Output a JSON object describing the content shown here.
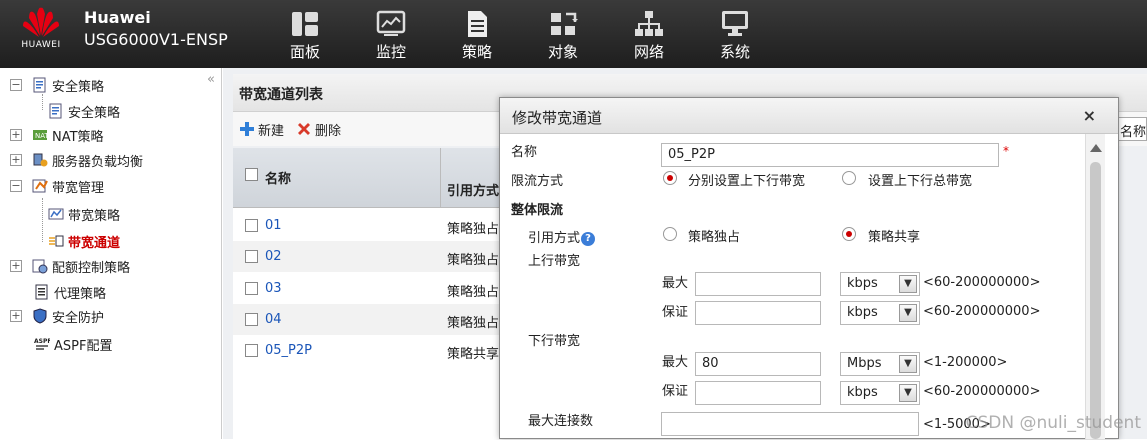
{
  "header": {
    "logo_text": "HUAWEI",
    "brand": "Huawei",
    "device": "USG6000V1-ENSP",
    "nav": [
      {
        "label": "面板",
        "icon": "dashboard-icon"
      },
      {
        "label": "监控",
        "icon": "monitor-chart-icon"
      },
      {
        "label": "策略",
        "icon": "document-icon"
      },
      {
        "label": "对象",
        "icon": "objects-icon"
      },
      {
        "label": "网络",
        "icon": "network-icon"
      },
      {
        "label": "系统",
        "icon": "computer-icon"
      }
    ]
  },
  "sidebar": {
    "collapse_icon": "«",
    "items": [
      {
        "label": "安全策略"
      },
      {
        "label": "安全策略"
      },
      {
        "label": "NAT策略"
      },
      {
        "label": "服务器负载均衡"
      },
      {
        "label": "带宽管理"
      },
      {
        "label": "带宽策略"
      },
      {
        "label": "带宽通道"
      },
      {
        "label": "配额控制策略"
      },
      {
        "label": "代理策略"
      },
      {
        "label": "安全防护"
      },
      {
        "label": "ASPF配置"
      }
    ]
  },
  "list_panel": {
    "title": "带宽通道列表",
    "new_label": "新建",
    "delete_label": "删除",
    "search_value": "名称",
    "col_name": "名称",
    "col_ref": "引用方式",
    "rows": [
      {
        "name": "01",
        "ref": "策略独占"
      },
      {
        "name": "02",
        "ref": "策略独占"
      },
      {
        "name": "03",
        "ref": "策略独占"
      },
      {
        "name": "04",
        "ref": "策略独占"
      },
      {
        "name": "05_P2P",
        "ref": "策略共享"
      }
    ]
  },
  "dialog": {
    "title": "修改带宽通道",
    "close_icon": "×",
    "name_label": "名称",
    "name_value": "05_P2P",
    "required_mark": "*",
    "limit_mode_label": "限流方式",
    "limit_opt1": "分别设置上下行带宽",
    "limit_opt2": "设置上下行总带宽",
    "section_overall": "整体限流",
    "ref_mode_label": "引用方式",
    "help_icon": "?",
    "ref_opt1": "策略独占",
    "ref_opt2": "策略共享",
    "uplink_label": "上行带宽",
    "downlink_label": "下行带宽",
    "max_label": "最大",
    "guarantee_label": "保证",
    "up_max_value": "",
    "up_max_unit": "kbps",
    "up_max_range": "<60-200000000>",
    "up_guar_value": "",
    "up_guar_unit": "kbps",
    "up_guar_range": "<60-200000000>",
    "down_max_value": "80",
    "down_max_unit": "Mbps",
    "down_max_range": "<1-200000>",
    "down_guar_value": "",
    "down_guar_unit": "kbps",
    "down_guar_range": "<60-200000000>",
    "max_conn_label": "最大连接数",
    "max_conn_value": "",
    "max_conn_range": "<1-5000>"
  },
  "watermark": "CSDN @nuli_student"
}
